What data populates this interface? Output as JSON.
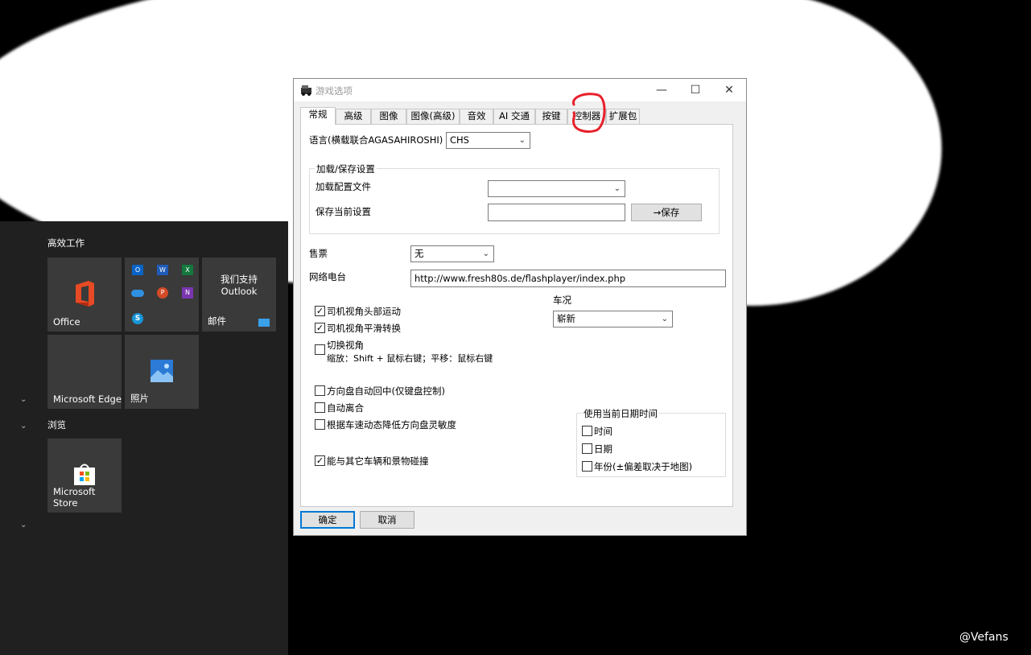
{
  "start_menu": {
    "group1_title": "高效工作",
    "group2_title": "浏览",
    "tiles": {
      "office": "Office",
      "outlook_support": "我们支持 Outlook",
      "mail": "邮件",
      "edge": "Microsoft Edge",
      "photos": "照片",
      "store": "Microsoft Store"
    }
  },
  "dialog": {
    "title": "游戏选项",
    "controls": {
      "minimize": "—",
      "maximize": "☐",
      "close": "✕"
    },
    "tabs": [
      "常规",
      "高级",
      "图像",
      "图像(高级)",
      "音效",
      "AI 交通",
      "按键",
      "控制器",
      "扩展包"
    ],
    "language_label": "语言(横载联合AGASAHIROSHI)",
    "language_value": "CHS",
    "load_save": {
      "title": "加载/保存设置",
      "load_label": "加载配置文件",
      "load_value": "",
      "save_label": "保存当前设置",
      "save_value": "",
      "save_button": "→保存"
    },
    "ticket_label": "售票",
    "ticket_value": "无",
    "radio_label": "网络电台",
    "radio_url": "http://www.fresh80s.de/flashplayer/index.php",
    "condition_label": "车况",
    "condition_value": "崭新",
    "checkboxes": {
      "head_motion": {
        "label": "司机视角头部运动",
        "checked": true
      },
      "smooth_turn": {
        "label": "司机视角平滑转换",
        "checked": true
      },
      "switch_view": {
        "label": "切换视角",
        "checked": false
      },
      "switch_view_hint": "缩放：Shift + 鼠标右键；平移：鼠标右键",
      "auto_center": {
        "label": "方向盘自动回中(仅键盘控制)",
        "checked": false
      },
      "auto_clutch": {
        "label": "自动离合",
        "checked": false
      },
      "speed_sens": {
        "label": "根据车速动态降低方向盘灵敏度",
        "checked": false
      },
      "collision": {
        "label": "能与其它车辆和景物碰撞",
        "checked": true
      }
    },
    "datetime": {
      "title": "使用当前日期时间",
      "time": {
        "label": "时间",
        "checked": false
      },
      "date": {
        "label": "日期",
        "checked": false
      },
      "year": {
        "label": "年份(±偏差取决于地图)",
        "checked": false
      }
    },
    "ok_button": "确定",
    "cancel_button": "取消"
  },
  "watermark": "@Vefans",
  "colors": {
    "annotation_red": "#e8202a",
    "focus_blue": "#0078d7"
  }
}
